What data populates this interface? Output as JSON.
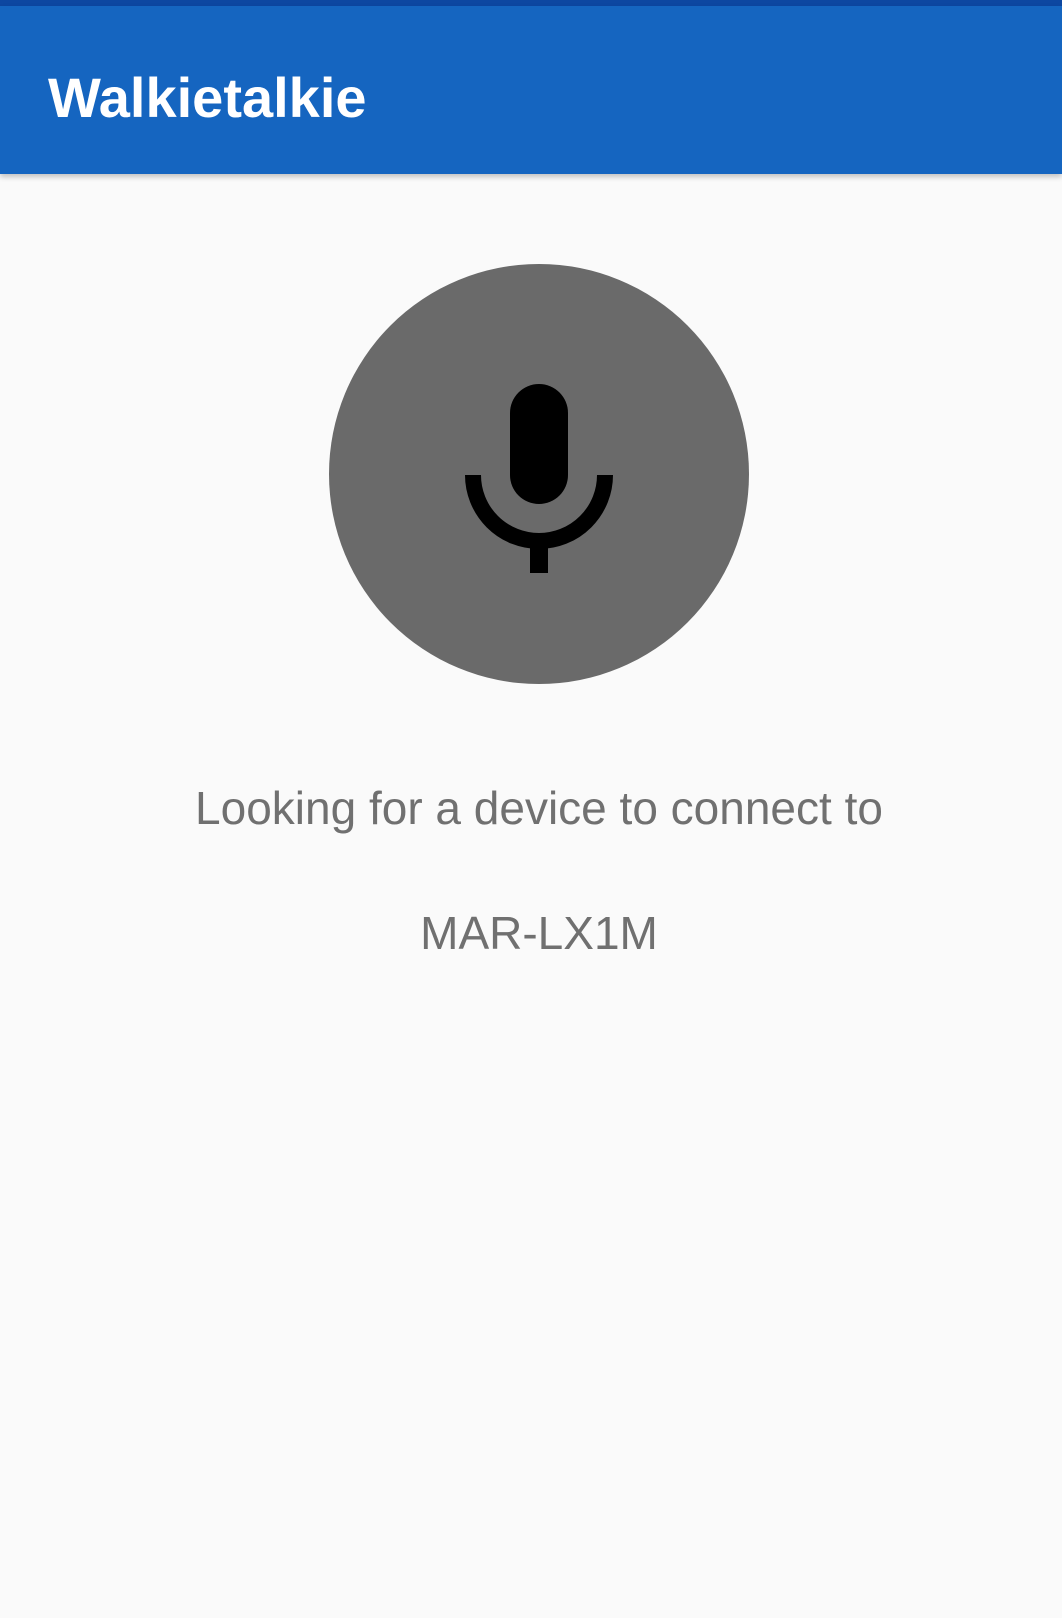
{
  "app_bar": {
    "title": "Walkietalkie",
    "color": "#1565c0"
  },
  "mic_button": {
    "icon": "microphone-icon",
    "color": "#6a6a6a"
  },
  "status": {
    "message": "Looking for a device to connect to",
    "device_name": "MAR-LX1M"
  }
}
